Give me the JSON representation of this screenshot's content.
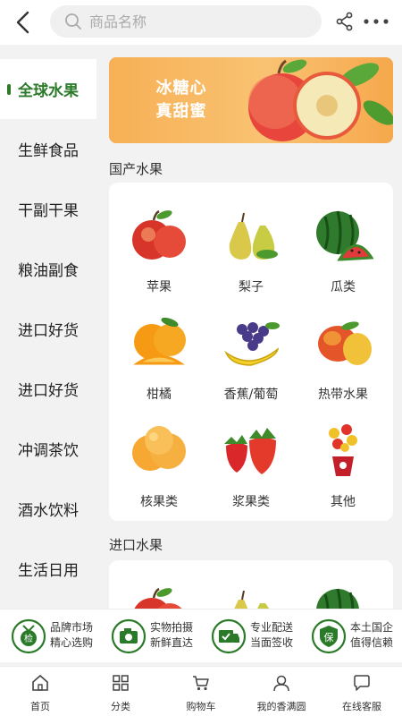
{
  "header": {
    "search_placeholder": "商品名称",
    "icons": {
      "back": "back-arrow-icon",
      "search": "search-icon",
      "share": "share-icon",
      "more": "more-dots-icon"
    }
  },
  "sidebar": {
    "items": [
      {
        "label": "全球水果",
        "active": true
      },
      {
        "label": "生鲜食品",
        "active": false
      },
      {
        "label": "干副干果",
        "active": false
      },
      {
        "label": "粮油副食",
        "active": false
      },
      {
        "label": "进口好货",
        "active": false
      },
      {
        "label": "进口好货",
        "active": false
      },
      {
        "label": "冲调茶饮",
        "active": false
      },
      {
        "label": "酒水饮料",
        "active": false
      },
      {
        "label": "生活日用",
        "active": false
      }
    ]
  },
  "banner": {
    "line1": "冰糖心",
    "line2": "真甜蜜"
  },
  "sections": [
    {
      "title": "国产水果",
      "items": [
        {
          "label": "苹果",
          "icon": "apple-icon"
        },
        {
          "label": "梨子",
          "icon": "pear-icon"
        },
        {
          "label": "瓜类",
          "icon": "watermelon-icon"
        },
        {
          "label": "柑橘",
          "icon": "orange-icon"
        },
        {
          "label": "香蕉/葡萄",
          "icon": "banana-grape-icon"
        },
        {
          "label": "热带水果",
          "icon": "mango-icon"
        },
        {
          "label": "核果类",
          "icon": "peach-icon"
        },
        {
          "label": "浆果类",
          "icon": "strawberry-icon"
        },
        {
          "label": "其他",
          "icon": "fruit-bouquet-icon"
        }
      ]
    },
    {
      "title": "进口水果",
      "items": [
        {
          "icon": "apple-icon"
        },
        {
          "icon": "pear-icon"
        },
        {
          "icon": "watermelon-icon"
        }
      ]
    }
  ],
  "features": [
    {
      "line1": "品牌市场",
      "line2": "精心选购",
      "icon": "medal-icon",
      "badge": "检"
    },
    {
      "line1": "实物拍摄",
      "line2": "新鲜直达",
      "icon": "camera-icon"
    },
    {
      "line1": "专业配送",
      "line2": "当面签收",
      "icon": "delivery-truck-icon"
    },
    {
      "line1": "本土国企",
      "line2": "值得信赖",
      "icon": "shield-icon",
      "badge": "保"
    }
  ],
  "tabbar": [
    {
      "label": "首页",
      "icon": "home-icon"
    },
    {
      "label": "分类",
      "icon": "category-grid-icon"
    },
    {
      "label": "购物车",
      "icon": "cart-icon"
    },
    {
      "label": "我的香满圆",
      "icon": "user-icon"
    },
    {
      "label": "在线客服",
      "icon": "chat-icon"
    }
  ],
  "colors": {
    "accent": "#2a7a2a",
    "banner": "#f7b055",
    "background": "#f2f2f2"
  }
}
